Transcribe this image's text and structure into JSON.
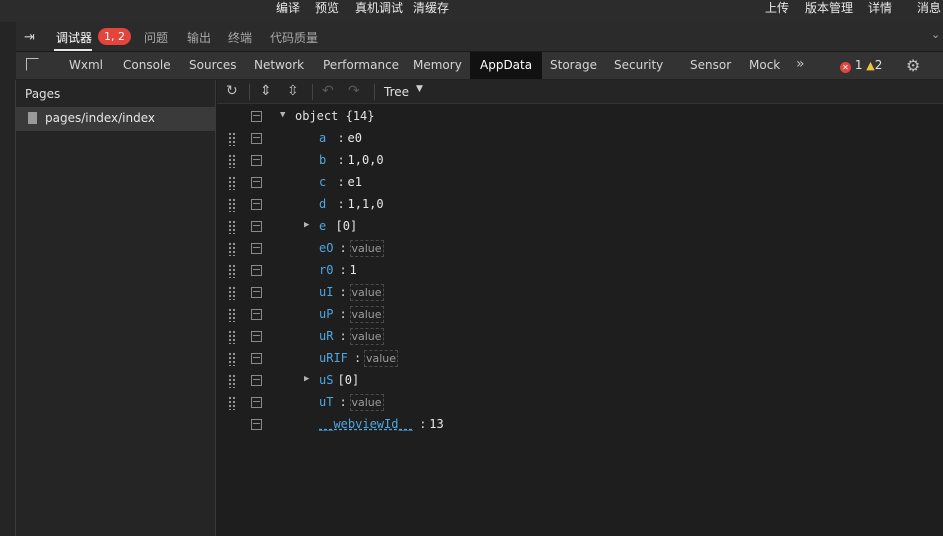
{
  "topbar": {
    "left_items": [
      "编译",
      "预览",
      "真机调试",
      "清缓存"
    ],
    "right_items": [
      "上传",
      "版本管理",
      "详情",
      "消息"
    ]
  },
  "debugger_bar": {
    "tabs": [
      "调试器",
      "问题",
      "输出",
      "终端",
      "代码质量"
    ],
    "active": "调试器",
    "badge": "1, 2",
    "collapse_icon": "chevron-down-icon"
  },
  "devtools": {
    "tabs": [
      "Wxml",
      "Console",
      "Sources",
      "Network",
      "Performance",
      "Memory",
      "AppData",
      "Storage",
      "Security",
      "Sensor",
      "Mock"
    ],
    "active_tab": "AppData",
    "more": "»",
    "error_count": "1",
    "warning_count": "2"
  },
  "pages_panel": {
    "title": "Pages",
    "items": [
      "pages/index/index"
    ]
  },
  "appdata": {
    "view_mode": "Tree",
    "root_label": "object {14}",
    "rows": [
      {
        "key": "a",
        "value": "e0",
        "kind": "text"
      },
      {
        "key": "b",
        "value": "1,0,0",
        "kind": "text"
      },
      {
        "key": "c",
        "value": "e1",
        "kind": "text"
      },
      {
        "key": "d",
        "value": "1,1,0",
        "kind": "text"
      },
      {
        "key": "e",
        "value": "[0]",
        "kind": "array"
      },
      {
        "key": "eO",
        "value": "value",
        "kind": "placeholder"
      },
      {
        "key": "r0",
        "value": "1",
        "kind": "text"
      },
      {
        "key": "uI",
        "value": "value",
        "kind": "placeholder"
      },
      {
        "key": "uP",
        "value": "value",
        "kind": "placeholder"
      },
      {
        "key": "uR",
        "value": "value",
        "kind": "placeholder"
      },
      {
        "key": "uRIF",
        "value": "value",
        "kind": "placeholder"
      },
      {
        "key": "uS",
        "value": "[0]",
        "kind": "array"
      },
      {
        "key": "uT",
        "value": "value",
        "kind": "placeholder"
      },
      {
        "key": "__webviewId__",
        "value": "13",
        "kind": "text"
      }
    ]
  },
  "colors": {
    "key": "#4fa6e0",
    "badge": "#e3453c",
    "warning": "#f0c23b",
    "active_tab_bg": "#111111"
  }
}
